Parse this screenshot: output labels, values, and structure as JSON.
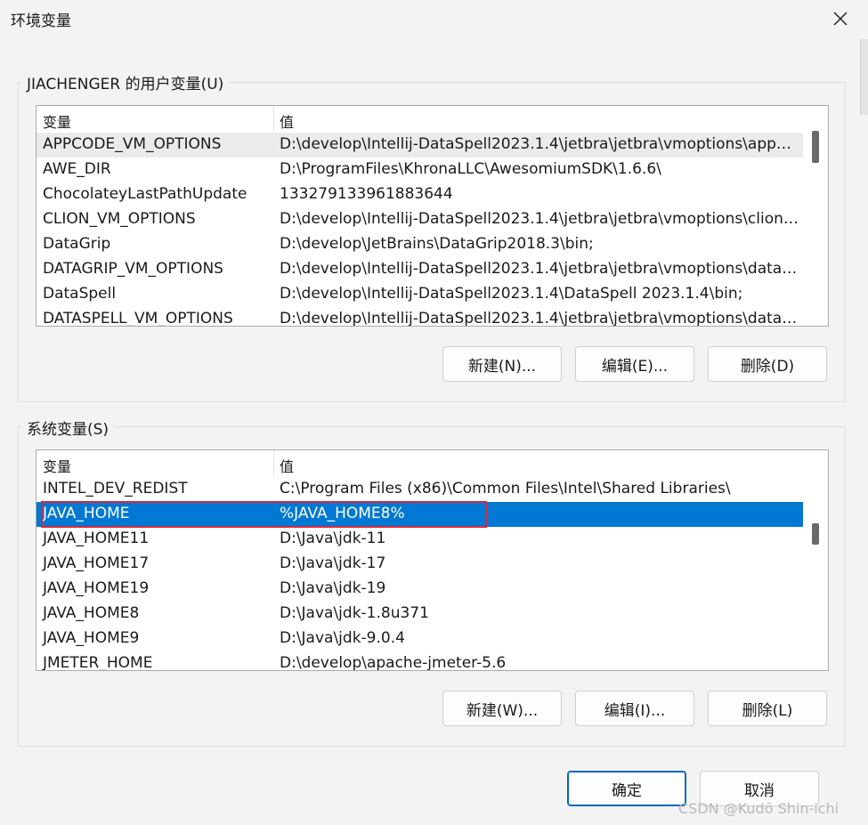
{
  "window": {
    "title": "环境变量"
  },
  "user_section": {
    "legend": "JIACHENGER 的用户变量(U)",
    "columns": [
      "变量",
      "值"
    ],
    "rows": [
      {
        "name": "APPCODE_VM_OPTIONS",
        "value": "D:\\develop\\Intellij-DataSpell2023.1.4\\jetbra\\jetbra\\vmoptions\\appcode.vmoptions"
      },
      {
        "name": "AWE_DIR",
        "value": "D:\\ProgramFiles\\KhronaLLC\\AwesomiumSDK\\1.6.6\\"
      },
      {
        "name": "ChocolateyLastPathUpdate",
        "value": "133279133961883644"
      },
      {
        "name": "CLION_VM_OPTIONS",
        "value": "D:\\develop\\Intellij-DataSpell2023.1.4\\jetbra\\jetbra\\vmoptions\\clion.vmoptions"
      },
      {
        "name": "DataGrip",
        "value": "D:\\develop\\JetBrains\\DataGrip2018.3\\bin;"
      },
      {
        "name": "DATAGRIP_VM_OPTIONS",
        "value": "D:\\develop\\Intellij-DataSpell2023.1.4\\jetbra\\jetbra\\vmoptions\\datagrip.vmoptions"
      },
      {
        "name": "DataSpell",
        "value": "D:\\develop\\Intellij-DataSpell2023.1.4\\DataSpell 2023.1.4\\bin;"
      },
      {
        "name": "DATASPELL_VM_OPTIONS",
        "value": "D:\\develop\\Intellij-DataSpell2023.1.4\\jetbra\\jetbra\\vmoptions\\dataspell.vmoptions"
      }
    ],
    "buttons": {
      "new": "新建(N)...",
      "edit": "编辑(E)...",
      "delete": "删除(D)"
    }
  },
  "system_section": {
    "legend": "系统变量(S)",
    "columns": [
      "变量",
      "值"
    ],
    "rows": [
      {
        "name": "INTEL_DEV_REDIST",
        "value": "C:\\Program Files (x86)\\Common Files\\Intel\\Shared Libraries\\"
      },
      {
        "name": "JAVA_HOME",
        "value": "%JAVA_HOME8%"
      },
      {
        "name": "JAVA_HOME11",
        "value": "D:\\Java\\jdk-11"
      },
      {
        "name": "JAVA_HOME17",
        "value": "D:\\Java\\jdk-17"
      },
      {
        "name": "JAVA_HOME19",
        "value": "D:\\Java\\jdk-19"
      },
      {
        "name": "JAVA_HOME8",
        "value": "D:\\Java\\jdk-1.8u371"
      },
      {
        "name": "JAVA_HOME9",
        "value": "D:\\Java\\jdk-9.0.4"
      },
      {
        "name": "JMETER_HOME",
        "value": "D:\\develop\\apache-jmeter-5.6"
      }
    ],
    "selected_row": "JAVA_HOME",
    "buttons": {
      "new": "新建(W)...",
      "edit": "编辑(I)...",
      "delete": "删除(L)"
    }
  },
  "footer": {
    "ok": "确定",
    "cancel": "取消"
  },
  "watermark": "CSDN @Kudō Shin-ichi",
  "colors": {
    "selection": "#0078d4",
    "annotation_box": "#d6283d",
    "background": "#f3f3f3"
  },
  "icons": {
    "close": "close-icon"
  }
}
